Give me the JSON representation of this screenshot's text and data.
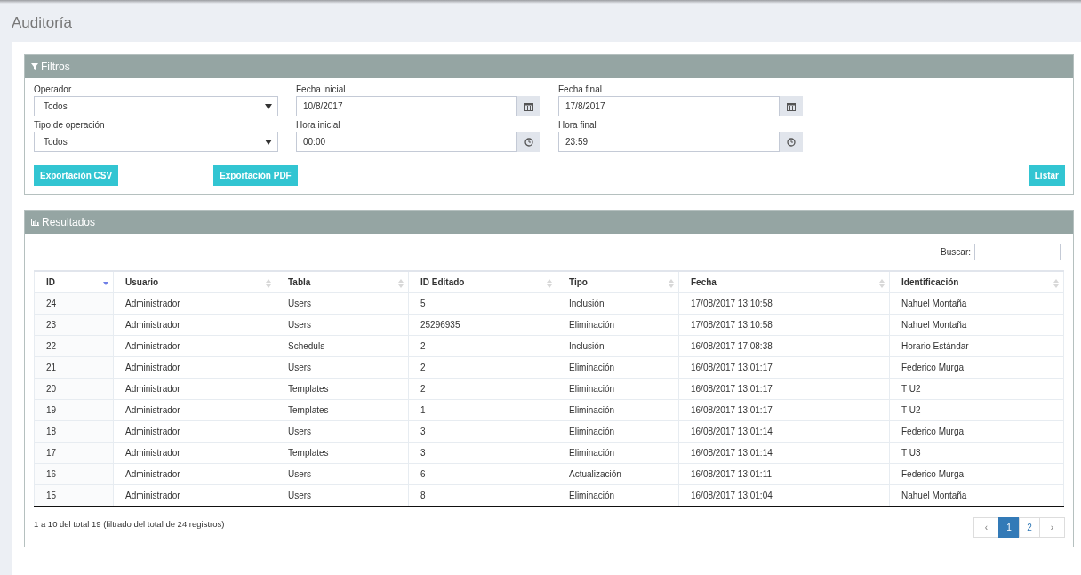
{
  "page_title": "Auditoría",
  "filters": {
    "title": "Filtros",
    "columns": [
      [
        {
          "label": "Operador",
          "kind": "select",
          "value": "Todos"
        },
        {
          "label": "Tipo de operación",
          "kind": "select",
          "value": "Todos"
        }
      ],
      [
        {
          "label": "Fecha inicial",
          "kind": "date",
          "value": "10/8/2017"
        },
        {
          "label": "Hora inicial",
          "kind": "time",
          "value": "00:00"
        }
      ],
      [
        {
          "label": "Fecha final",
          "kind": "date",
          "value": "17/8/2017"
        },
        {
          "label": "Hora final",
          "kind": "time",
          "value": "23:59"
        }
      ]
    ],
    "buttons": [
      {
        "label": "Exportación CSV",
        "right_aligned": false
      },
      {
        "label": "Exportación PDF",
        "right_aligned": false
      },
      {
        "label": "Listar",
        "right_aligned": true
      }
    ]
  },
  "results": {
    "title": "Resultados",
    "search_label": "Buscar:",
    "table": {
      "columns": [
        {
          "label": "ID",
          "sorted": true
        },
        {
          "label": "Usuario",
          "sorted": false
        },
        {
          "label": "Tabla",
          "sorted": false
        },
        {
          "label": "ID Editado",
          "sorted": false
        },
        {
          "label": "Tipo",
          "sorted": false
        },
        {
          "label": "Fecha",
          "sorted": false
        },
        {
          "label": "Identificación",
          "sorted": false
        }
      ],
      "rows": [
        [
          "24",
          "Administrador",
          "Users",
          "5",
          "Inclusión",
          "17/08/2017 13:10:58",
          "Nahuel Montaña"
        ],
        [
          "23",
          "Administrador",
          "Users",
          "25296935",
          "Eliminación",
          "17/08/2017 13:10:58",
          "Nahuel Montaña"
        ],
        [
          "22",
          "Administrador",
          "Scheduls",
          "2",
          "Inclusión",
          "16/08/2017 17:08:38",
          "Horario Estándar"
        ],
        [
          "21",
          "Administrador",
          "Users",
          "2",
          "Eliminación",
          "16/08/2017 13:01:17",
          "Federico Murga"
        ],
        [
          "20",
          "Administrador",
          "Templates",
          "2",
          "Eliminación",
          "16/08/2017 13:01:17",
          "T U2"
        ],
        [
          "19",
          "Administrador",
          "Templates",
          "1",
          "Eliminación",
          "16/08/2017 13:01:17",
          "T U2"
        ],
        [
          "18",
          "Administrador",
          "Users",
          "3",
          "Eliminación",
          "16/08/2017 13:01:14",
          "Federico Murga"
        ],
        [
          "17",
          "Administrador",
          "Templates",
          "3",
          "Eliminación",
          "16/08/2017 13:01:14",
          "T U3"
        ],
        [
          "16",
          "Administrador",
          "Users",
          "6",
          "Actualización",
          "16/08/2017 13:01:11",
          "Federico Murga"
        ],
        [
          "15",
          "Administrador",
          "Users",
          "8",
          "Eliminación",
          "16/08/2017 13:01:04",
          "Nahuel Montaña"
        ]
      ]
    },
    "info": "1 a 10 del total 19 (filtrado del total de 24 registros)",
    "pagination": [
      {
        "label": "‹",
        "kind": "prev",
        "selected": false
      },
      {
        "label": "1",
        "kind": "page",
        "selected": true
      },
      {
        "label": "2",
        "kind": "page",
        "selected": false
      },
      {
        "label": "›",
        "kind": "next",
        "selected": false
      }
    ]
  }
}
